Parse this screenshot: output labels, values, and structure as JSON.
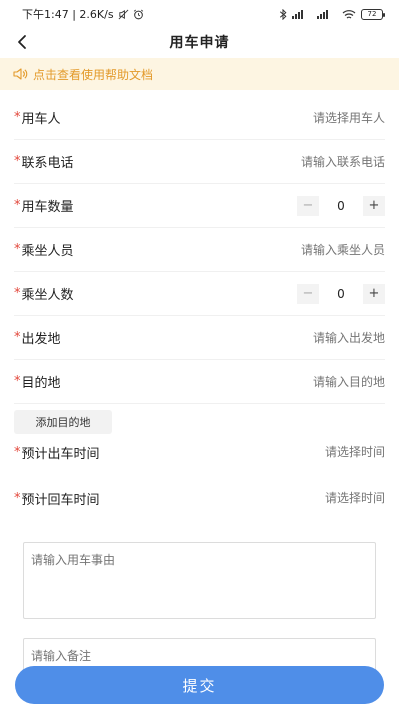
{
  "status_bar": {
    "time_net": "下午1:47 | 2.6K/s",
    "battery": "72"
  },
  "nav": {
    "title": "用车申请"
  },
  "notice": {
    "text": "点击查看使用帮助文档"
  },
  "required_mark": "*",
  "fields": {
    "user": {
      "label": "用车人",
      "placeholder": "请选择用车人"
    },
    "phone": {
      "label": "联系电话",
      "placeholder": "请输入联系电话"
    },
    "vehicle_count": {
      "label": "用车数量",
      "value": "0",
      "minus": "−",
      "plus": "+"
    },
    "passengers": {
      "label": "乘坐人员",
      "placeholder": "请输入乘坐人员"
    },
    "passenger_count": {
      "label": "乘坐人数",
      "value": "0",
      "minus": "−",
      "plus": "+"
    },
    "origin": {
      "label": "出发地",
      "placeholder": "请输入出发地"
    },
    "destination": {
      "label": "目的地",
      "placeholder": "请输入目的地"
    },
    "depart_time": {
      "label": "预计出车时间",
      "placeholder": "请选择时间"
    },
    "return_time": {
      "label": "预计回车时间",
      "placeholder": "请选择时间"
    }
  },
  "add_destination_label": "添加目的地",
  "reason_placeholder": "请输入用车事由",
  "remark_placeholder": "请输入备注",
  "submit_label": "提交",
  "colors": {
    "accent": "#4f8ee8",
    "notice_bg": "#fdf5e2",
    "notice_text": "#e39a2b",
    "required": "#e2463a"
  }
}
